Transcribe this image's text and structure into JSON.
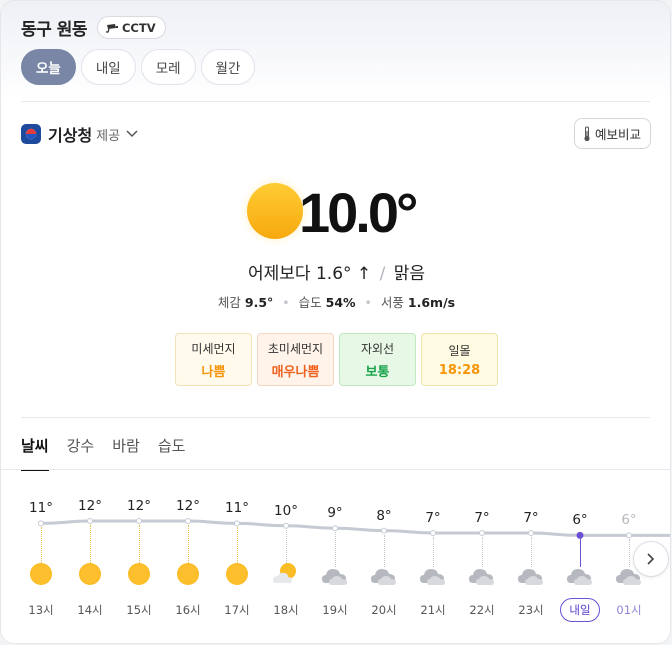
{
  "header": {
    "location": "동구 원동",
    "cctv_label": "CCTV"
  },
  "tabs": [
    {
      "label": "오늘",
      "active": true
    },
    {
      "label": "내일",
      "active": false
    },
    {
      "label": "모레",
      "active": false
    },
    {
      "label": "월간",
      "active": false
    }
  ],
  "provider": {
    "name": "기상청",
    "suffix": "제공"
  },
  "compare_button": "예보비교",
  "current": {
    "temperature": "10.0°",
    "compare_prefix": "어제보다",
    "compare_value": "1.6°",
    "compare_arrow": "↑",
    "condition": "맑음",
    "feels_label": "체감",
    "feels_value": "9.5°",
    "humidity_label": "습도",
    "humidity_value": "54%",
    "wind_label": "서풍",
    "wind_value": "1.6m/s"
  },
  "badges": [
    {
      "label": "미세먼지",
      "value": "나쁨",
      "color": "#f5950b",
      "bg": "#fffaeb",
      "border": "#f1e3b6"
    },
    {
      "label": "초미세먼지",
      "value": "매우나쁨",
      "color": "#f0621f",
      "bg": "#fff3ea",
      "border": "#f4d6c2"
    },
    {
      "label": "자외선",
      "value": "보통",
      "color": "#17a34a",
      "bg": "#e7f9e6",
      "border": "#bfe8c0"
    },
    {
      "label": "일몰",
      "value": "18:28",
      "color": "#f5950b",
      "bg": "#fffbe3",
      "border": "#ece3ad"
    }
  ],
  "subtabs": [
    {
      "label": "날씨",
      "active": true
    },
    {
      "label": "강수",
      "active": false
    },
    {
      "label": "바람",
      "active": false
    },
    {
      "label": "습도",
      "active": false
    }
  ],
  "hourly": [
    {
      "time": "13시",
      "temp": 11,
      "temp_label": "11°",
      "icon": "sun-icon"
    },
    {
      "time": "14시",
      "temp": 12,
      "temp_label": "12°",
      "icon": "sun-icon"
    },
    {
      "time": "15시",
      "temp": 12,
      "temp_label": "12°",
      "icon": "sun-icon"
    },
    {
      "time": "16시",
      "temp": 12,
      "temp_label": "12°",
      "icon": "sun-icon"
    },
    {
      "time": "17시",
      "temp": 11,
      "temp_label": "11°",
      "icon": "sun-icon"
    },
    {
      "time": "18시",
      "temp": 10,
      "temp_label": "10°",
      "icon": "partly-cloudy-icon"
    },
    {
      "time": "19시",
      "temp": 9,
      "temp_label": "9°",
      "icon": "cloud-icon"
    },
    {
      "time": "20시",
      "temp": 8,
      "temp_label": "8°",
      "icon": "cloud-icon"
    },
    {
      "time": "21시",
      "temp": 7,
      "temp_label": "7°",
      "icon": "cloud-icon"
    },
    {
      "time": "22시",
      "temp": 7,
      "temp_label": "7°",
      "icon": "cloud-icon"
    },
    {
      "time": "23시",
      "temp": 7,
      "temp_label": "7°",
      "icon": "cloud-icon"
    },
    {
      "time": "내일",
      "temp": 6,
      "temp_label": "6°",
      "icon": "cloud-icon",
      "next_day": true
    },
    {
      "time": "01시",
      "temp": 6,
      "temp_label": "6°",
      "icon": "cloud-icon",
      "faded": true
    }
  ]
}
